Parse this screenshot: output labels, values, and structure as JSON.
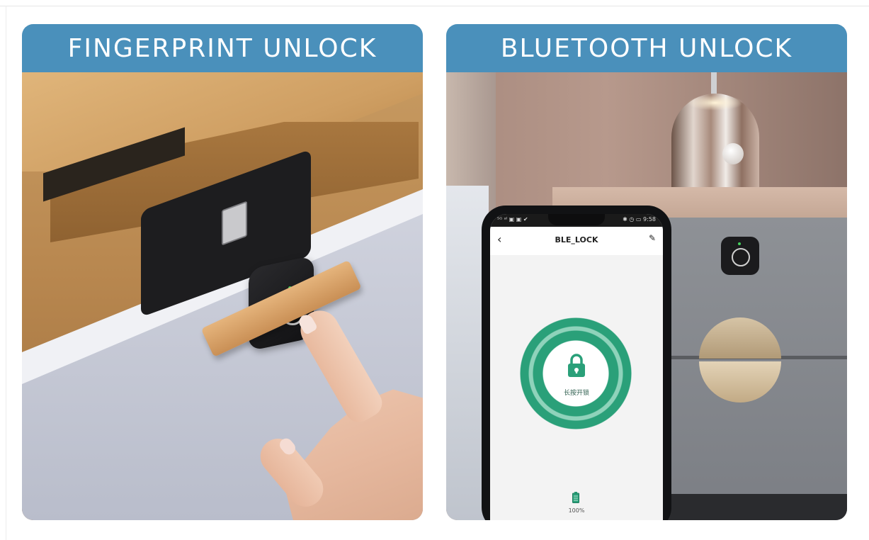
{
  "panels": [
    {
      "banner_title": "FINGERPRINT UNLOCK",
      "banner_color": "#4a90bb"
    },
    {
      "banner_title": "BLUETOOTH UNLOCK",
      "banner_color": "#4a90bb",
      "phone": {
        "status_left": "⁵ᴳ ᵃˡ ▣ ▣ ✔",
        "status_right": "✱ ◷ ▭ 9:58",
        "app_title": "BLE_LOCK",
        "back_icon": "chevron-left-icon",
        "edit_icon": "edit-pencil-icon",
        "unlock_label": "长按开锁",
        "accent_color": "#2aa079",
        "battery_level": "100%"
      }
    }
  ]
}
